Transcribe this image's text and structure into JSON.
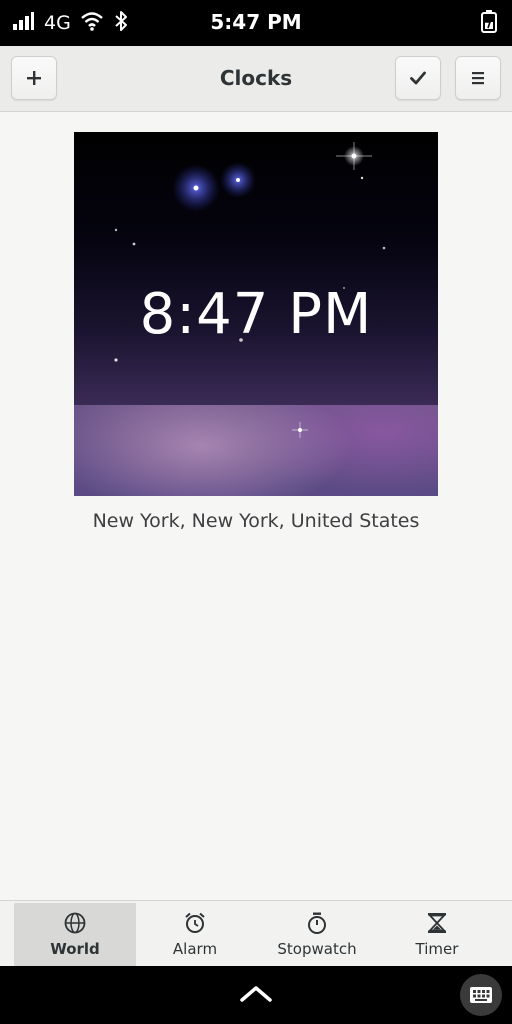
{
  "status_bar": {
    "network": "4G",
    "time": "5:47 PM"
  },
  "header": {
    "title": "Clocks"
  },
  "world_clock": {
    "time": "8:47 PM",
    "location": "New York, New York, United States"
  },
  "switcher": {
    "items": [
      {
        "label": "World",
        "icon": "globe-icon",
        "active": true
      },
      {
        "label": "Alarm",
        "icon": "alarm-clock-icon",
        "active": false
      },
      {
        "label": "Stopwatch",
        "icon": "stopwatch-icon",
        "active": false
      },
      {
        "label": "Timer",
        "icon": "hourglass-icon",
        "active": false
      }
    ]
  },
  "colors": {
    "status_bar_bg": "#000000",
    "header_bg": "#ebebea",
    "content_bg": "#f6f6f5",
    "active_tab_bg": "#d8d8d6"
  }
}
